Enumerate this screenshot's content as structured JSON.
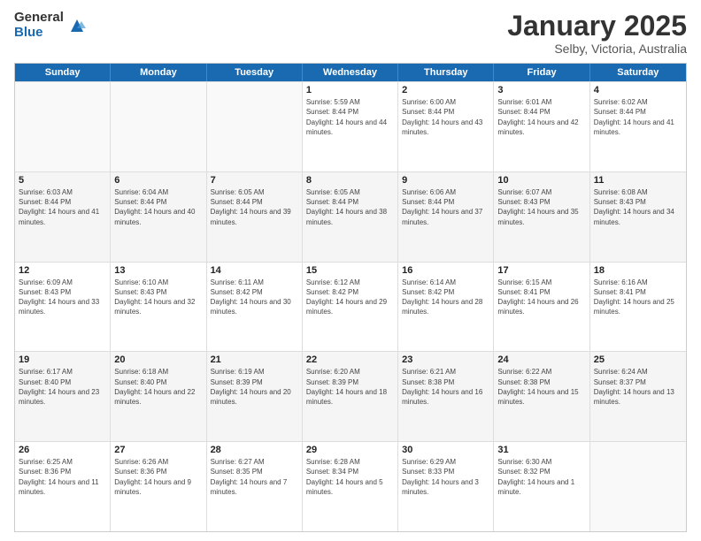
{
  "logo": {
    "general": "General",
    "blue": "Blue"
  },
  "title": {
    "month": "January 2025",
    "location": "Selby, Victoria, Australia"
  },
  "calendar": {
    "headers": [
      "Sunday",
      "Monday",
      "Tuesday",
      "Wednesday",
      "Thursday",
      "Friday",
      "Saturday"
    ],
    "rows": [
      [
        {
          "day": "",
          "sunrise": "",
          "sunset": "",
          "daylight": "",
          "empty": true
        },
        {
          "day": "",
          "sunrise": "",
          "sunset": "",
          "daylight": "",
          "empty": true
        },
        {
          "day": "",
          "sunrise": "",
          "sunset": "",
          "daylight": "",
          "empty": true
        },
        {
          "day": "1",
          "sunrise": "Sunrise: 5:59 AM",
          "sunset": "Sunset: 8:44 PM",
          "daylight": "Daylight: 14 hours and 44 minutes."
        },
        {
          "day": "2",
          "sunrise": "Sunrise: 6:00 AM",
          "sunset": "Sunset: 8:44 PM",
          "daylight": "Daylight: 14 hours and 43 minutes."
        },
        {
          "day": "3",
          "sunrise": "Sunrise: 6:01 AM",
          "sunset": "Sunset: 8:44 PM",
          "daylight": "Daylight: 14 hours and 42 minutes."
        },
        {
          "day": "4",
          "sunrise": "Sunrise: 6:02 AM",
          "sunset": "Sunset: 8:44 PM",
          "daylight": "Daylight: 14 hours and 41 minutes."
        }
      ],
      [
        {
          "day": "5",
          "sunrise": "Sunrise: 6:03 AM",
          "sunset": "Sunset: 8:44 PM",
          "daylight": "Daylight: 14 hours and 41 minutes."
        },
        {
          "day": "6",
          "sunrise": "Sunrise: 6:04 AM",
          "sunset": "Sunset: 8:44 PM",
          "daylight": "Daylight: 14 hours and 40 minutes."
        },
        {
          "day": "7",
          "sunrise": "Sunrise: 6:05 AM",
          "sunset": "Sunset: 8:44 PM",
          "daylight": "Daylight: 14 hours and 39 minutes."
        },
        {
          "day": "8",
          "sunrise": "Sunrise: 6:05 AM",
          "sunset": "Sunset: 8:44 PM",
          "daylight": "Daylight: 14 hours and 38 minutes."
        },
        {
          "day": "9",
          "sunrise": "Sunrise: 6:06 AM",
          "sunset": "Sunset: 8:44 PM",
          "daylight": "Daylight: 14 hours and 37 minutes."
        },
        {
          "day": "10",
          "sunrise": "Sunrise: 6:07 AM",
          "sunset": "Sunset: 8:43 PM",
          "daylight": "Daylight: 14 hours and 35 minutes."
        },
        {
          "day": "11",
          "sunrise": "Sunrise: 6:08 AM",
          "sunset": "Sunset: 8:43 PM",
          "daylight": "Daylight: 14 hours and 34 minutes."
        }
      ],
      [
        {
          "day": "12",
          "sunrise": "Sunrise: 6:09 AM",
          "sunset": "Sunset: 8:43 PM",
          "daylight": "Daylight: 14 hours and 33 minutes."
        },
        {
          "day": "13",
          "sunrise": "Sunrise: 6:10 AM",
          "sunset": "Sunset: 8:43 PM",
          "daylight": "Daylight: 14 hours and 32 minutes."
        },
        {
          "day": "14",
          "sunrise": "Sunrise: 6:11 AM",
          "sunset": "Sunset: 8:42 PM",
          "daylight": "Daylight: 14 hours and 30 minutes."
        },
        {
          "day": "15",
          "sunrise": "Sunrise: 6:12 AM",
          "sunset": "Sunset: 8:42 PM",
          "daylight": "Daylight: 14 hours and 29 minutes."
        },
        {
          "day": "16",
          "sunrise": "Sunrise: 6:14 AM",
          "sunset": "Sunset: 8:42 PM",
          "daylight": "Daylight: 14 hours and 28 minutes."
        },
        {
          "day": "17",
          "sunrise": "Sunrise: 6:15 AM",
          "sunset": "Sunset: 8:41 PM",
          "daylight": "Daylight: 14 hours and 26 minutes."
        },
        {
          "day": "18",
          "sunrise": "Sunrise: 6:16 AM",
          "sunset": "Sunset: 8:41 PM",
          "daylight": "Daylight: 14 hours and 25 minutes."
        }
      ],
      [
        {
          "day": "19",
          "sunrise": "Sunrise: 6:17 AM",
          "sunset": "Sunset: 8:40 PM",
          "daylight": "Daylight: 14 hours and 23 minutes."
        },
        {
          "day": "20",
          "sunrise": "Sunrise: 6:18 AM",
          "sunset": "Sunset: 8:40 PM",
          "daylight": "Daylight: 14 hours and 22 minutes."
        },
        {
          "day": "21",
          "sunrise": "Sunrise: 6:19 AM",
          "sunset": "Sunset: 8:39 PM",
          "daylight": "Daylight: 14 hours and 20 minutes."
        },
        {
          "day": "22",
          "sunrise": "Sunrise: 6:20 AM",
          "sunset": "Sunset: 8:39 PM",
          "daylight": "Daylight: 14 hours and 18 minutes."
        },
        {
          "day": "23",
          "sunrise": "Sunrise: 6:21 AM",
          "sunset": "Sunset: 8:38 PM",
          "daylight": "Daylight: 14 hours and 16 minutes."
        },
        {
          "day": "24",
          "sunrise": "Sunrise: 6:22 AM",
          "sunset": "Sunset: 8:38 PM",
          "daylight": "Daylight: 14 hours and 15 minutes."
        },
        {
          "day": "25",
          "sunrise": "Sunrise: 6:24 AM",
          "sunset": "Sunset: 8:37 PM",
          "daylight": "Daylight: 14 hours and 13 minutes."
        }
      ],
      [
        {
          "day": "26",
          "sunrise": "Sunrise: 6:25 AM",
          "sunset": "Sunset: 8:36 PM",
          "daylight": "Daylight: 14 hours and 11 minutes."
        },
        {
          "day": "27",
          "sunrise": "Sunrise: 6:26 AM",
          "sunset": "Sunset: 8:36 PM",
          "daylight": "Daylight: 14 hours and 9 minutes."
        },
        {
          "day": "28",
          "sunrise": "Sunrise: 6:27 AM",
          "sunset": "Sunset: 8:35 PM",
          "daylight": "Daylight: 14 hours and 7 minutes."
        },
        {
          "day": "29",
          "sunrise": "Sunrise: 6:28 AM",
          "sunset": "Sunset: 8:34 PM",
          "daylight": "Daylight: 14 hours and 5 minutes."
        },
        {
          "day": "30",
          "sunrise": "Sunrise: 6:29 AM",
          "sunset": "Sunset: 8:33 PM",
          "daylight": "Daylight: 14 hours and 3 minutes."
        },
        {
          "day": "31",
          "sunrise": "Sunrise: 6:30 AM",
          "sunset": "Sunset: 8:32 PM",
          "daylight": "Daylight: 14 hours and 1 minute."
        },
        {
          "day": "",
          "sunrise": "",
          "sunset": "",
          "daylight": "",
          "empty": true
        }
      ]
    ]
  }
}
